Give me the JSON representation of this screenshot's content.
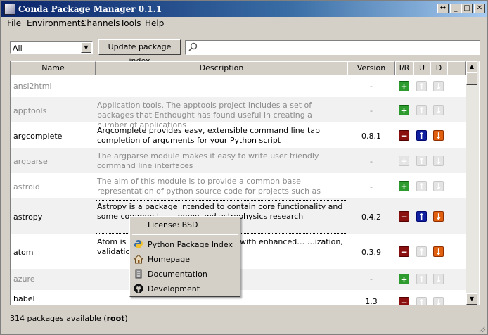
{
  "window": {
    "title": "Conda Package Manager 0.1.1",
    "buttons": [
      "↔",
      "_",
      "□",
      "✕"
    ]
  },
  "menu": [
    "File",
    "Environments",
    "Channels",
    "Tools",
    "Help"
  ],
  "toolbar": {
    "filter_value": "All",
    "update_label": "Update package index",
    "search_value": ""
  },
  "table": {
    "headers": {
      "name": "Name",
      "description": "Description",
      "version": "Version",
      "ir": "I/R",
      "u": "U",
      "d": "D"
    },
    "rows": [
      {
        "name": "ansi2html",
        "description": "",
        "version": "-",
        "installed": false
      },
      {
        "name": "apptools",
        "description": "Application tools. The apptools project includes a set of packages that Enthought has found useful in creating a number of applications",
        "version": "-",
        "installed": false
      },
      {
        "name": "argcomplete",
        "description": "Argcomplete provides easy, extensible command line tab completion of arguments for your Python script",
        "version": "0.8.1",
        "installed": true
      },
      {
        "name": "argparse",
        "description": "The argparse module makes it easy to write user friendly command line interfaces",
        "version": "-",
        "installed": false
      },
      {
        "name": "astroid",
        "description": "The aim of this module is to provide a common base representation of python source code for projects such as pychecker, pyreverse, pylint…",
        "version": "-",
        "installed": false
      },
      {
        "name": "astropy",
        "description": "Astropy is a package intended to contain core functionality and some common t… …nomy and astrophysics research",
        "version": "0.4.2",
        "installed": true
      },
      {
        "name": "atom",
        "description": "Atom is a… …fficient Python objects with enhanced… …ization, validation, and change notificati…",
        "version": "0.3.9",
        "installed": true
      },
      {
        "name": "azure",
        "description": "",
        "version": "-",
        "installed": false
      },
      {
        "name": "babel",
        "description": "",
        "version": "1.3",
        "installed": true
      }
    ]
  },
  "status": {
    "prefix": "314 packages available (",
    "env": "root",
    "suffix": ")"
  },
  "context_menu": {
    "license": "License: BSD",
    "items": [
      "Python Package Index",
      "Homepage",
      "Documentation",
      "Development"
    ]
  },
  "colors": {
    "install": "#2e9b2e",
    "remove": "#8a1010",
    "upgrade": "#1020a0",
    "downgrade": "#e06010",
    "disabled": "#e4e4e4",
    "titlebar": "#0a246a"
  }
}
